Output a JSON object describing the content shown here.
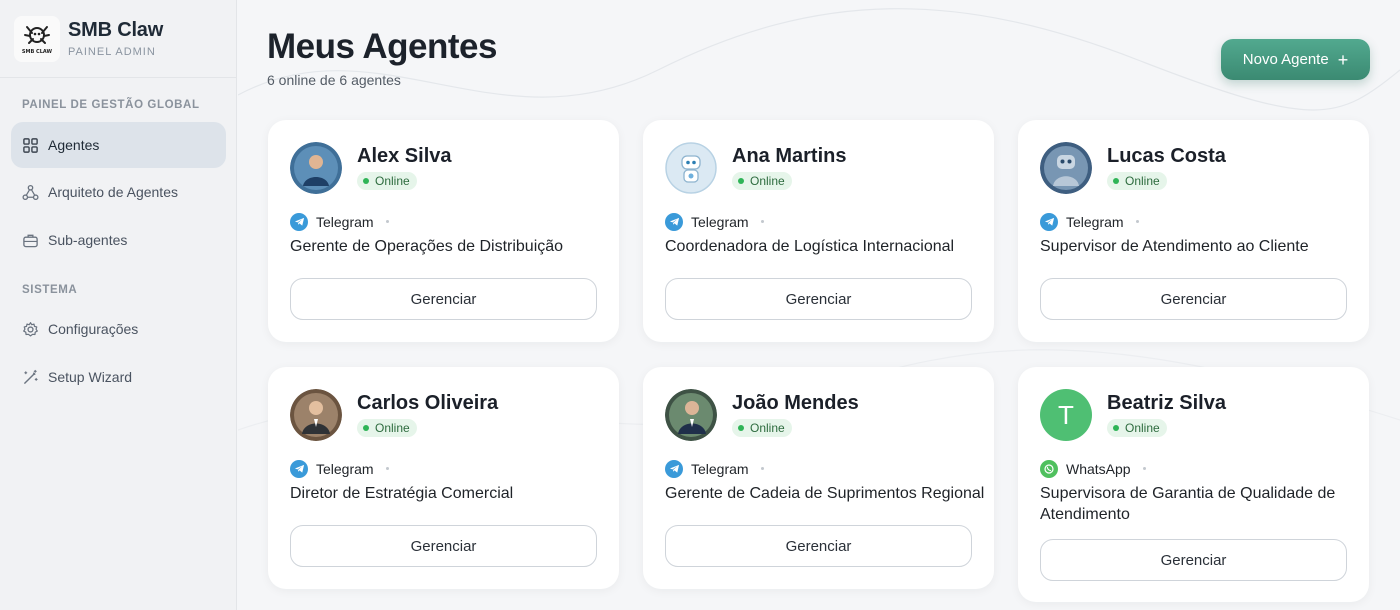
{
  "brand": {
    "name": "SMB Claw",
    "subtitle": "PAINEL ADMIN",
    "logo_text": "SMB CLAW"
  },
  "sidebar": {
    "section_global": "PAINEL DE GESTÃO GLOBAL",
    "section_system": "SISTEMA",
    "items": [
      {
        "label": "Agentes",
        "icon": "grid-icon",
        "active": true
      },
      {
        "label": "Arquiteto de Agentes",
        "icon": "nodes-icon"
      },
      {
        "label": "Sub-agentes",
        "icon": "briefcase-icon"
      },
      {
        "label": "Configurações",
        "icon": "gear-icon"
      },
      {
        "label": "Setup Wizard",
        "icon": "magic-wand-icon"
      }
    ]
  },
  "header": {
    "title": "Meus Agentes",
    "subtitle": "6 online de 6 agentes",
    "new_button": "Novo Agente",
    "new_button_icon": "plus-icon"
  },
  "colors": {
    "accent": "#3f8f77",
    "online_dot": "#2fb457",
    "telegram": "#3a9ad9",
    "whatsapp": "#4fc05e",
    "avatar_letter_bg": "#4fbf73"
  },
  "agents": [
    {
      "name": "Alex Silva",
      "status": "Online",
      "channel": "Telegram",
      "role": "Gerente de Operações de Distribuição",
      "action": "Gerenciar",
      "avatar": "photo"
    },
    {
      "name": "Ana Martins",
      "status": "Online",
      "channel": "Telegram",
      "role": "Coordenadora de Logística Internacional",
      "action": "Gerenciar",
      "avatar": "robot"
    },
    {
      "name": "Lucas Costa",
      "status": "Online",
      "channel": "Telegram",
      "role": "Supervisor de Atendimento ao Cliente",
      "action": "Gerenciar",
      "avatar": "robot-photo"
    },
    {
      "name": "Carlos Oliveira",
      "status": "Online",
      "channel": "Telegram",
      "role": "Diretor de Estratégia Comercial",
      "action": "Gerenciar",
      "avatar": "photo"
    },
    {
      "name": "João Mendes",
      "status": "Online",
      "channel": "Telegram",
      "role": "Gerente de Cadeia de Suprimentos Regional",
      "action": "Gerenciar",
      "avatar": "photo"
    },
    {
      "name": "Beatriz Silva",
      "status": "Online",
      "channel": "WhatsApp",
      "role": "Supervisora de Garantia de Qualidade de Atendimento",
      "action": "Gerenciar",
      "avatar": "letter",
      "avatar_letter": "T"
    }
  ]
}
